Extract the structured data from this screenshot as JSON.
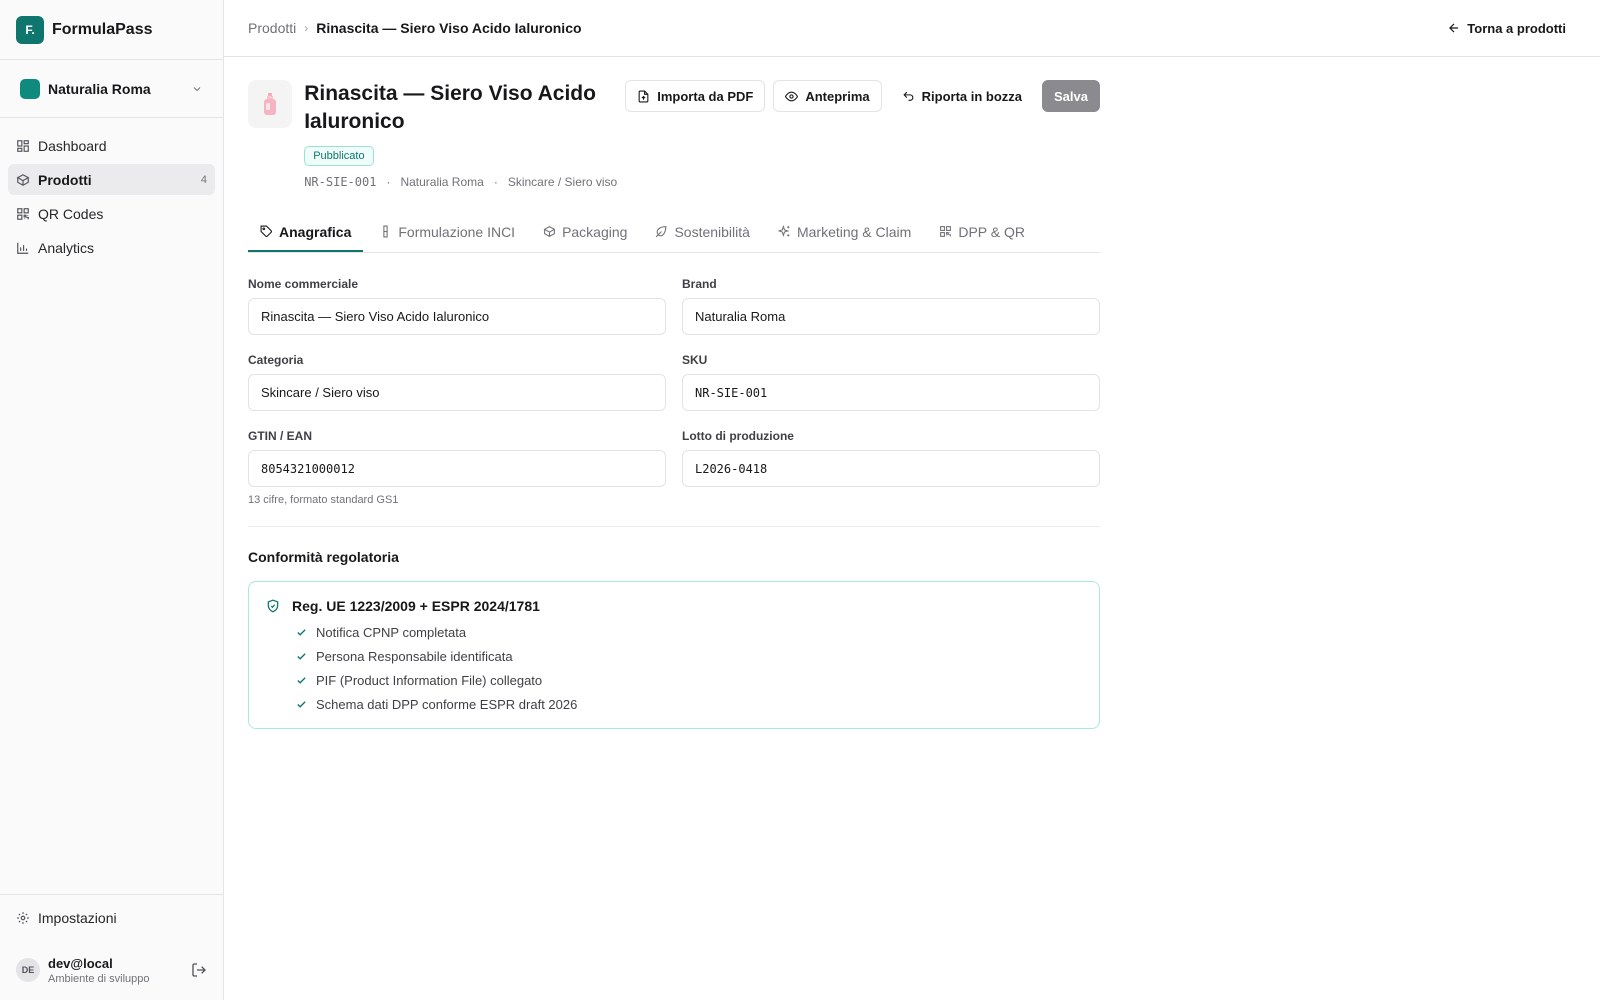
{
  "brand": {
    "logo_text": "F.",
    "name": "FormulaPass"
  },
  "org": {
    "name": "Naturalia Roma"
  },
  "nav": [
    {
      "label": "Dashboard",
      "icon": "dashboard-icon"
    },
    {
      "label": "Prodotti",
      "icon": "box-icon",
      "count": "4",
      "active": true
    },
    {
      "label": "QR Codes",
      "icon": "qr-code-icon"
    },
    {
      "label": "Analytics",
      "icon": "bar-chart-icon"
    }
  ],
  "settings": {
    "label": "Impostazioni"
  },
  "user": {
    "initials": "DE",
    "name": "dev@local",
    "env": "Ambiente di sviluppo"
  },
  "breadcrumb": {
    "parent": "Prodotti",
    "current": "Rinascita — Siero Viso Acido Ialuronico"
  },
  "back_link": "Torna a prodotti",
  "product": {
    "title": "Rinascita — Siero Viso Acido Ialuronico",
    "status": "Pubblicato",
    "sku": "NR-SIE-001",
    "brand": "Naturalia Roma",
    "category": "Skincare / Siero viso"
  },
  "actions": {
    "import_pdf": "Importa da PDF",
    "preview": "Anteprima",
    "revert_draft": "Riporta in bozza",
    "save": "Salva"
  },
  "tabs": [
    {
      "label": "Anagrafica",
      "active": true
    },
    {
      "label": "Formulazione INCI"
    },
    {
      "label": "Packaging"
    },
    {
      "label": "Sostenibilità"
    },
    {
      "label": "Marketing & Claim"
    },
    {
      "label": "DPP & QR"
    }
  ],
  "form": {
    "commercial_name": {
      "label": "Nome commerciale",
      "value": "Rinascita — Siero Viso Acido Ialuronico"
    },
    "brand": {
      "label": "Brand",
      "value": "Naturalia Roma"
    },
    "category": {
      "label": "Categoria",
      "value": "Skincare / Siero viso"
    },
    "sku": {
      "label": "SKU",
      "value": "NR-SIE-001"
    },
    "gtin": {
      "label": "GTIN / EAN",
      "value": "8054321000012",
      "hint": "13 cifre, formato standard GS1"
    },
    "lot": {
      "label": "Lotto di produzione",
      "value": "L2026-0418"
    }
  },
  "compliance": {
    "section_title": "Conformità regolatoria",
    "title": "Reg. UE 1223/2009 + ESPR 2024/1781",
    "items": [
      "Notifica CPNP completata",
      "Persona Responsabile identificata",
      "PIF (Product Information File) collegato",
      "Schema dati DPP conforme ESPR draft 2026"
    ]
  },
  "colors": {
    "accent": "#0f766e",
    "save_disabled": "#8a8a8f"
  }
}
